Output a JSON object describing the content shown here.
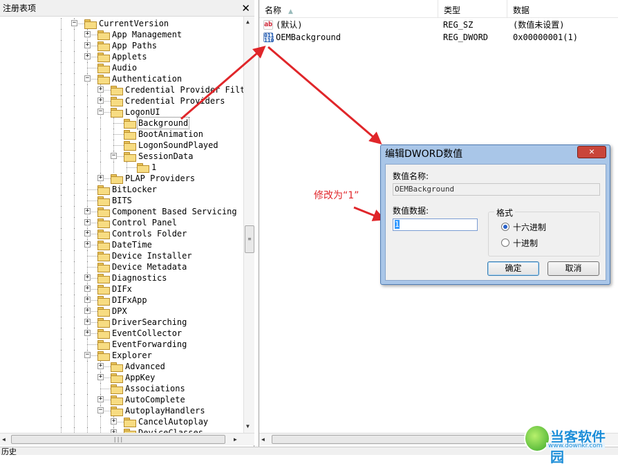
{
  "left_pane": {
    "title": "注册表项",
    "close_symbol": "✕",
    "tree": [
      {
        "label": "CurrentVersion",
        "expander": "−",
        "indent": 2
      },
      {
        "label": "App Management",
        "expander": "+",
        "indent": 3
      },
      {
        "label": "App Paths",
        "expander": "+",
        "indent": 3
      },
      {
        "label": "Applets",
        "expander": "+",
        "indent": 3
      },
      {
        "label": "Audio",
        "expander": "",
        "indent": 3
      },
      {
        "label": "Authentication",
        "expander": "−",
        "indent": 3
      },
      {
        "label": "Credential Provider Filters",
        "expander": "+",
        "indent": 4
      },
      {
        "label": "Credential Providers",
        "expander": "+",
        "indent": 4
      },
      {
        "label": "LogonUI",
        "expander": "−",
        "indent": 4
      },
      {
        "label": "Background",
        "expander": "",
        "indent": 5,
        "selected": true
      },
      {
        "label": "BootAnimation",
        "expander": "",
        "indent": 5
      },
      {
        "label": "LogonSoundPlayed",
        "expander": "",
        "indent": 5
      },
      {
        "label": "SessionData",
        "expander": "−",
        "indent": 5
      },
      {
        "label": "1",
        "expander": "",
        "indent": 6
      },
      {
        "label": "PLAP Providers",
        "expander": "+",
        "indent": 4
      },
      {
        "label": "BitLocker",
        "expander": "",
        "indent": 3
      },
      {
        "label": "BITS",
        "expander": "",
        "indent": 3
      },
      {
        "label": "Component Based Servicing",
        "expander": "+",
        "indent": 3
      },
      {
        "label": "Control Panel",
        "expander": "+",
        "indent": 3
      },
      {
        "label": "Controls Folder",
        "expander": "+",
        "indent": 3
      },
      {
        "label": "DateTime",
        "expander": "+",
        "indent": 3
      },
      {
        "label": "Device Installer",
        "expander": "",
        "indent": 3
      },
      {
        "label": "Device Metadata",
        "expander": "",
        "indent": 3
      },
      {
        "label": "Diagnostics",
        "expander": "+",
        "indent": 3
      },
      {
        "label": "DIFx",
        "expander": "+",
        "indent": 3
      },
      {
        "label": "DIFxApp",
        "expander": "+",
        "indent": 3
      },
      {
        "label": "DPX",
        "expander": "+",
        "indent": 3
      },
      {
        "label": "DriverSearching",
        "expander": "+",
        "indent": 3
      },
      {
        "label": "EventCollector",
        "expander": "+",
        "indent": 3
      },
      {
        "label": "EventForwarding",
        "expander": "",
        "indent": 3
      },
      {
        "label": "Explorer",
        "expander": "−",
        "indent": 3
      },
      {
        "label": "Advanced",
        "expander": "+",
        "indent": 4
      },
      {
        "label": "AppKey",
        "expander": "+",
        "indent": 4
      },
      {
        "label": "Associations",
        "expander": "",
        "indent": 4
      },
      {
        "label": "AutoComplete",
        "expander": "+",
        "indent": 4
      },
      {
        "label": "AutoplayHandlers",
        "expander": "−",
        "indent": 4
      },
      {
        "label": "CancelAutoplay",
        "expander": "+",
        "indent": 5
      },
      {
        "label": "DeviceClasses",
        "expander": "+",
        "indent": 5
      }
    ]
  },
  "right_pane": {
    "columns": {
      "name": "名称",
      "type": "类型",
      "data": "数据"
    },
    "rows": [
      {
        "icon": "string-value-icon",
        "glyph": "ab",
        "name": "(默认)",
        "type": "REG_SZ",
        "data": "(数值未设置)"
      },
      {
        "icon": "dword-value-icon",
        "glyph": "011\n110",
        "name": "OEMBackground",
        "type": "REG_DWORD",
        "data": "0x00000001(1)"
      }
    ]
  },
  "dialog": {
    "title": "编辑DWORD数值",
    "close_symbol": "✕",
    "value_name_label": "数值名称:",
    "value_name": "OEMBackground",
    "value_data_label": "数值数据:",
    "value_data": "1",
    "format_legend": "格式",
    "radio_hex": "十六进制",
    "radio_dec": "十进制",
    "ok_label": "确定",
    "cancel_label": "取消"
  },
  "annotation": {
    "text": "修改为“1”",
    "color": "#e0262a"
  },
  "statusbar": {
    "text": "历史"
  },
  "watermark": {
    "text": "当客软件园",
    "url": "www.downkr.com",
    "url_partial": "downkr.com"
  },
  "scrollbar": {
    "up": "▲",
    "down": "▼",
    "left": "◀",
    "right": "▶",
    "grip": "≡",
    "hgrip": "|||"
  }
}
